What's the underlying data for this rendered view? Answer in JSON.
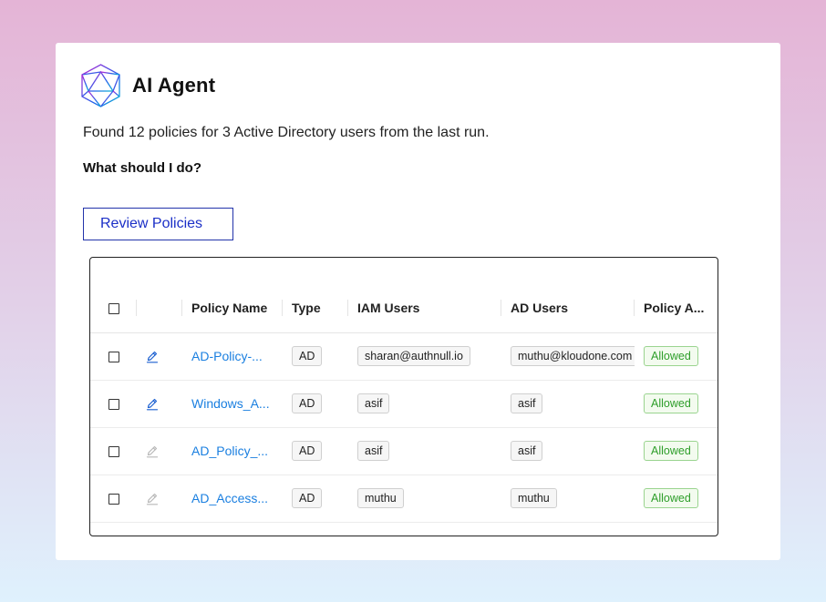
{
  "agent": {
    "title": "AI Agent",
    "message": "Found 12 policies for 3 Active Directory users from the last run.",
    "question": "What should I do?",
    "review_button": "Review Policies",
    "logo_icon": "polyhedron-logo-icon",
    "logo_colors": [
      "#c026d3",
      "#2563eb",
      "#06b6d4"
    ]
  },
  "table": {
    "columns": [
      "Policy Name",
      "Type",
      "IAM Users",
      "AD Users",
      "Policy A..."
    ],
    "rows": [
      {
        "name": "AD-Policy-...",
        "type": "AD",
        "iam": "sharan@authnull.io",
        "ad": "muthu@kloudone.com",
        "status": "Allowed",
        "edit_active": true
      },
      {
        "name": "Windows_A...",
        "type": "AD",
        "iam": "asif",
        "ad": "asif",
        "status": "Allowed",
        "edit_active": true
      },
      {
        "name": "AD_Policy_...",
        "type": "AD",
        "iam": "asif",
        "ad": "asif",
        "status": "Allowed",
        "edit_active": false
      },
      {
        "name": "AD_Access...",
        "type": "AD",
        "iam": "muthu",
        "ad": "muthu",
        "status": "Allowed",
        "edit_active": false
      }
    ],
    "colors": {
      "link": "#1a7fe0",
      "edit_active": "#1a5fd0",
      "edit_inactive": "#b8b8b8",
      "allowed": "#2e9e2a"
    }
  }
}
